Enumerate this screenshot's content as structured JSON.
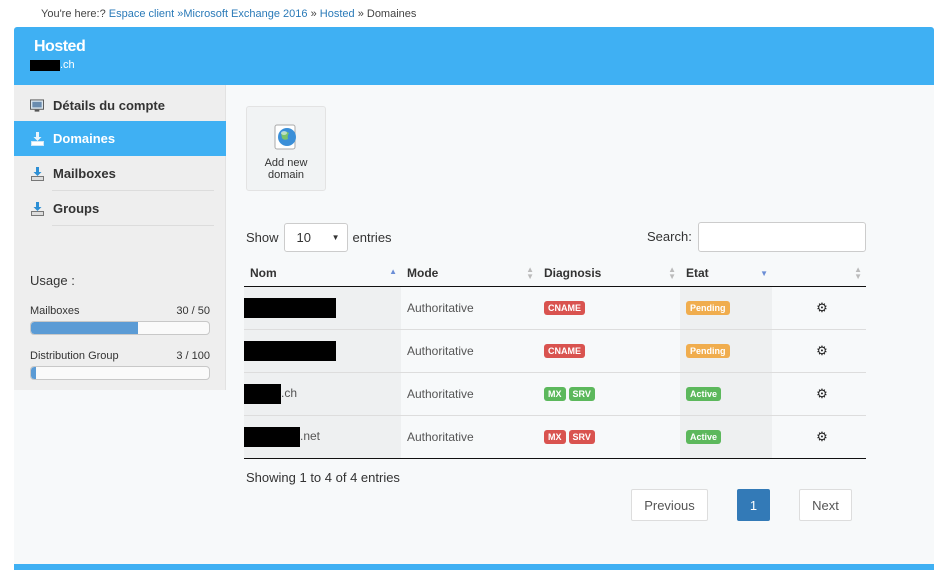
{
  "breadcrumb": {
    "prefix": "You're here:?",
    "items": [
      "Espace client",
      "»Microsoft Exchange 2016",
      "Hosted",
      "Domaines"
    ]
  },
  "header": {
    "title": "Hosted",
    "domain_suffix": ".ch"
  },
  "sidebar": {
    "items": [
      {
        "label": "Détails du compte",
        "icon": "monitor-icon",
        "active": false
      },
      {
        "label": "Domaines",
        "icon": "download-tray-icon",
        "active": true
      },
      {
        "label": "Mailboxes",
        "icon": "download-tray-icon",
        "active": false
      },
      {
        "label": "Groups",
        "icon": "download-tray-icon",
        "active": false
      }
    ],
    "usage_title": "Usage :",
    "usage": [
      {
        "label": "Mailboxes",
        "value": "30 / 50",
        "fraction": 0.6
      },
      {
        "label": "Distribution Group",
        "value": "3 / 100",
        "fraction": 0.03
      }
    ]
  },
  "add_tile": {
    "label_line1": "Add new",
    "label_line2": "domain",
    "icon": "globe-icon"
  },
  "table_controls": {
    "show_label": "Show",
    "entries_value": "10",
    "entries_label": "entries",
    "search_label": "Search:"
  },
  "table": {
    "columns": [
      "Nom",
      "Mode",
      "Diagnosis",
      "Etat"
    ],
    "rows": [
      {
        "name_suffix": "",
        "mode": "Authoritative",
        "diagnosis": [
          {
            "text": "CNAME",
            "color": "red"
          }
        ],
        "etat": {
          "text": "Pending",
          "color": "orange"
        }
      },
      {
        "name_suffix": "",
        "mode": "Authoritative",
        "diagnosis": [
          {
            "text": "CNAME",
            "color": "red"
          }
        ],
        "etat": {
          "text": "Pending",
          "color": "orange"
        }
      },
      {
        "name_suffix": ".ch",
        "mode": "Authoritative",
        "diagnosis": [
          {
            "text": "MX",
            "color": "green"
          },
          {
            "text": "SRV",
            "color": "green"
          }
        ],
        "etat": {
          "text": "Active",
          "color": "green"
        }
      },
      {
        "name_suffix": ".net",
        "mode": "Authoritative",
        "diagnosis": [
          {
            "text": "MX",
            "color": "red"
          },
          {
            "text": "SRV",
            "color": "red"
          }
        ],
        "etat": {
          "text": "Active",
          "color": "green"
        }
      }
    ]
  },
  "info": "Showing 1 to 4 of 4 entries",
  "pagination": {
    "previous": "Previous",
    "page": "1",
    "next": "Next"
  },
  "colors": {
    "accent": "#3fb0f3",
    "danger": "#d9534f",
    "success": "#5cb85c",
    "warning": "#f0ad4e",
    "primary": "#337ab7"
  }
}
